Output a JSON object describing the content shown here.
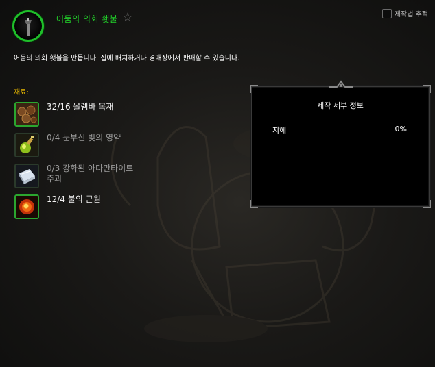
{
  "recipe": {
    "title": "어둠의 의회 횃불",
    "description": "어둠의 의회 횃불을 만듭니다. 집에 배치하거나 경매장에서 판매할 수 있습니다.",
    "icon": "torch-icon",
    "favorite_icon": "star-outline-icon"
  },
  "track": {
    "label": "제작법 추적",
    "checked": false
  },
  "reagents": {
    "label": "재료:",
    "items": [
      {
        "text": "32/16 올렘바 목재",
        "icon": "lumber-icon",
        "sufficient": true
      },
      {
        "text": "0/4 눈부신 빛의 영약",
        "icon": "potion-icon",
        "sufficient": false
      },
      {
        "text": "0/3 강화된 아다만타이트 주괴",
        "icon": "ingot-icon",
        "sufficient": false
      },
      {
        "text": "12/4 불의 근원",
        "icon": "fire-essence-icon",
        "sufficient": true
      }
    ]
  },
  "details": {
    "title": "제작 세부 정보",
    "stat_label": "지혜",
    "stat_value": "0%"
  },
  "colors": {
    "title_green": "#22d22a",
    "reagent_label_gold": "#e8b800",
    "border_green": "#2ba62f"
  }
}
